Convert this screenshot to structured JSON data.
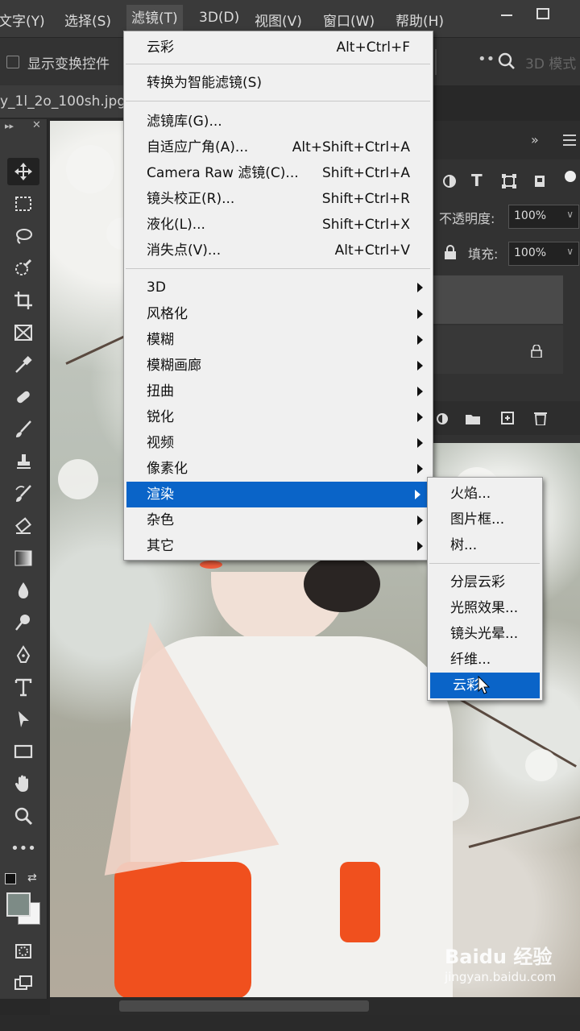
{
  "menubar": {
    "items": [
      "文字(Y)",
      "选择(S)",
      "滤镜(T)",
      "3D(D)",
      "视图(V)",
      "窗口(W)",
      "帮助(H)"
    ]
  },
  "options_bar": {
    "show_transform_label": "显示变换控件",
    "mode3d_label": "3D 模式"
  },
  "document_tab": {
    "title": "y_1l_2o_100sh.jpg"
  },
  "panel": {
    "opacity_label": "不透明度:",
    "opacity_value": "100%",
    "fill_label": "填充:",
    "fill_value": "100%"
  },
  "filter_menu": {
    "items": [
      {
        "label": "云彩",
        "shortcut": "Alt+Ctrl+F"
      },
      {
        "label": "转换为智能滤镜(S)",
        "shortcut": ""
      },
      {
        "label": "滤镜库(G)...",
        "shortcut": ""
      },
      {
        "label": "自适应广角(A)...",
        "shortcut": "Alt+Shift+Ctrl+A"
      },
      {
        "label": "Camera Raw 滤镜(C)...",
        "shortcut": "Shift+Ctrl+A"
      },
      {
        "label": "镜头校正(R)...",
        "shortcut": "Shift+Ctrl+R"
      },
      {
        "label": "液化(L)...",
        "shortcut": "Shift+Ctrl+X"
      },
      {
        "label": "消失点(V)...",
        "shortcut": "Alt+Ctrl+V"
      },
      {
        "label": "3D",
        "shortcut": ""
      },
      {
        "label": "风格化",
        "shortcut": ""
      },
      {
        "label": "模糊",
        "shortcut": ""
      },
      {
        "label": "模糊画廊",
        "shortcut": ""
      },
      {
        "label": "扭曲",
        "shortcut": ""
      },
      {
        "label": "锐化",
        "shortcut": ""
      },
      {
        "label": "视频",
        "shortcut": ""
      },
      {
        "label": "像素化",
        "shortcut": ""
      },
      {
        "label": "渲染",
        "shortcut": ""
      },
      {
        "label": "杂色",
        "shortcut": ""
      },
      {
        "label": "其它",
        "shortcut": ""
      }
    ],
    "highlighted": "渲染"
  },
  "render_submenu": {
    "items": [
      "火焰...",
      "图片框...",
      "树...",
      "分层云彩",
      "光照效果...",
      "镜头光晕...",
      "纤维...",
      "云彩"
    ],
    "highlighted": "云彩"
  },
  "watermark": {
    "brand": "Baidu 经验",
    "url": "jingyan.baidu.com"
  },
  "colors": {
    "highlight": "#0a64c8",
    "menu_bg": "#f0f0f0",
    "ui_dark": "#3a3a3a"
  }
}
